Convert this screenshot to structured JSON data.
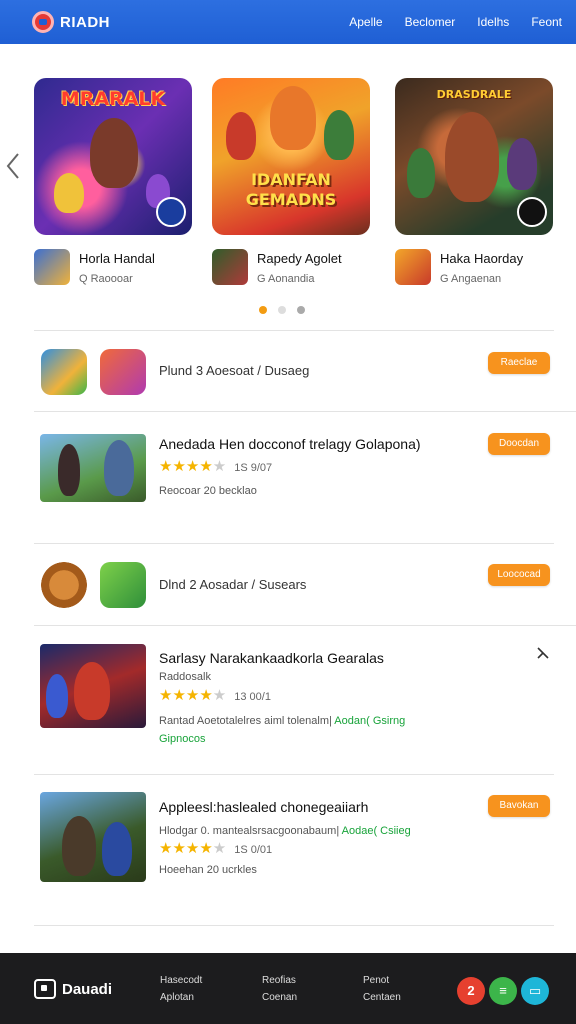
{
  "header": {
    "logo_text": "RIADH",
    "nav": [
      "Apelle",
      "Beclomer",
      "Idelhs",
      "Feont"
    ],
    "accent_color": "#1f5fd4"
  },
  "carousel": {
    "prev_icon": "chevron-left-icon",
    "cards": [
      {
        "art_title": "MRARALK",
        "name": "Horla Handal",
        "sub": "Q Raoooar"
      },
      {
        "art_title": "IDANFAN GEMADNS",
        "name": "Rapedy Agolet",
        "sub": "G Aonandia"
      },
      {
        "art_title": "DRASDRALE",
        "name": "Haka Haorday",
        "sub": "G Angaenan"
      }
    ],
    "dots": 3,
    "active_dot": 0
  },
  "list": [
    {
      "type": "pair",
      "label": "Plund 3 Aoesoat / Dusaeg",
      "button": "Raeclae"
    },
    {
      "type": "item",
      "title": "Anedada Hen docconof trelagy Golapona)",
      "rating": 4,
      "count": "1S 9/07",
      "sub": "Reocoar 20 becklao",
      "button": "Doocdan"
    },
    {
      "type": "pair",
      "label": "Dlnd 2 Aosadar / Susears",
      "button": "Loococad"
    },
    {
      "type": "item",
      "title": "Sarlasy Narakankaadkorla Gearalas",
      "sub_top": "Raddosalk",
      "rating": 4,
      "count": "13 00/1",
      "sub_plain": "Rantad Aoetotalelres aiml tolenalm|",
      "sub_green": "Aodan( Gsirng Gipnocos",
      "close_icon": "close-icon"
    },
    {
      "type": "item",
      "title": "Appleesl:haslealed chonegeaiiarh",
      "sub_top_plain": "Hlodgar 0. mantealsrsacgoonabaum|",
      "sub_top_green": "Aodae( Csiieg",
      "rating": 4,
      "count": "1S 0/01",
      "sub": "Hoeehan 20 ucrkles",
      "button": "Bavokan"
    }
  ],
  "footer": {
    "logo_text": "Dauadi",
    "col1": [
      "Hasecodt",
      "Aplotan"
    ],
    "col2": [
      "Reofias",
      "Coenan"
    ],
    "col3": [
      "Penot",
      "Centaen"
    ],
    "badges": [
      {
        "text": "2",
        "color": "#e6402f"
      },
      {
        "text": "≡",
        "color": "#3cb54a"
      },
      {
        "text": "▭",
        "color": "#1eb6d8"
      }
    ]
  }
}
